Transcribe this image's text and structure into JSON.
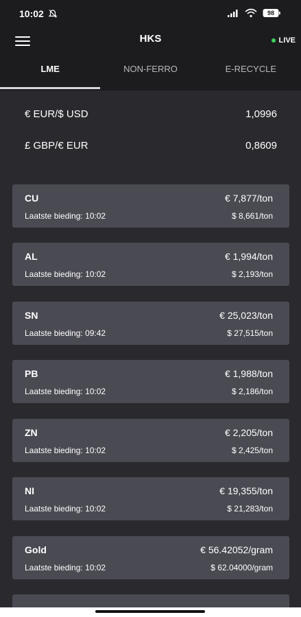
{
  "status_bar": {
    "time": "10:02",
    "battery": "98",
    "icons": [
      "mute-icon",
      "signal-icon",
      "wifi-icon",
      "battery-icon"
    ]
  },
  "header": {
    "title": "HKS",
    "live_label": "LIVE",
    "live_color": "#3cd15a"
  },
  "tabs": [
    {
      "label": "LME",
      "active": true
    },
    {
      "label": "NON-FERRO",
      "active": false
    },
    {
      "label": "E-RECYCLE",
      "active": false
    }
  ],
  "exchange_rates": [
    {
      "label": "€ EUR/$ USD",
      "value": "1,0996"
    },
    {
      "label": "£ GBP/€ EUR",
      "value": "0,8609"
    }
  ],
  "metals": [
    {
      "name": "CU",
      "eur": "€ 7,877/ton",
      "time": "Laatste bieding: 10:02",
      "usd": "$ 8,661/ton"
    },
    {
      "name": "AL",
      "eur": "€ 1,994/ton",
      "time": "Laatste bieding: 10:02",
      "usd": "$ 2,193/ton"
    },
    {
      "name": "SN",
      "eur": "€ 25,023/ton",
      "time": "Laatste bieding: 09:42",
      "usd": "$ 27,515/ton"
    },
    {
      "name": "PB",
      "eur": "€ 1,988/ton",
      "time": "Laatste bieding: 10:02",
      "usd": "$ 2,186/ton"
    },
    {
      "name": "ZN",
      "eur": "€ 2,205/ton",
      "time": "Laatste bieding: 10:02",
      "usd": "$ 2,425/ton"
    },
    {
      "name": "NI",
      "eur": "€ 19,355/ton",
      "time": "Laatste bieding: 10:02",
      "usd": "$ 21,283/ton"
    },
    {
      "name": "Gold",
      "eur": "€ 56.42052/gram",
      "time": "Laatste bieding: 10:02",
      "usd": "$ 62.04000/gram"
    }
  ],
  "colors": {
    "background": "#2a2a2e",
    "header": "#1c1c1f",
    "card": "#4a4a53"
  }
}
